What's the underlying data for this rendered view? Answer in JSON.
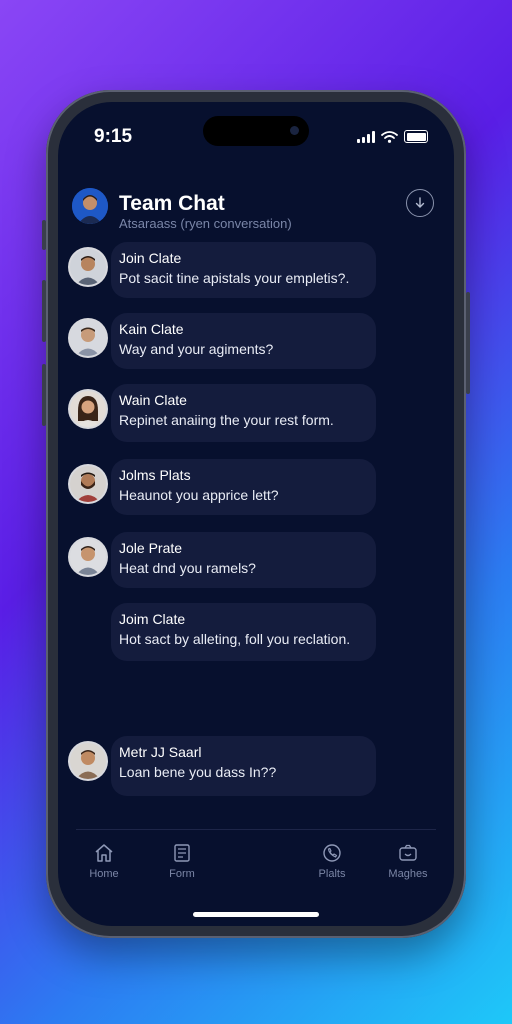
{
  "status_bar": {
    "time": "9:15"
  },
  "header": {
    "title": "Team Chat",
    "subtitle": "Atsaraass (ryen conversation)",
    "action_icon": "download-icon"
  },
  "messages": [
    {
      "name": "Join Clate",
      "text": "Pot sacit tine apistals your empletis?."
    },
    {
      "name": "Kain Clate",
      "text": "Way and your agiments?"
    },
    {
      "name": "Wain Clate",
      "text": "Repinet anaiing the your rest form."
    },
    {
      "name": "Jolms Plats",
      "text": "Heaunot you apprice lett?"
    },
    {
      "name": "Jole Prate",
      "text": "Heat dnd you ramels?"
    },
    {
      "name": "Joim Clate",
      "text": "Hot sact by alleting, foll you reclation."
    },
    {
      "name": "Metr JJ Saarl",
      "text": "Loan bene you dass In??"
    }
  ],
  "bottom_nav": [
    {
      "label": "Home",
      "icon": "home-icon"
    },
    {
      "label": "Form",
      "icon": "form-icon"
    },
    {
      "label": "Plalts",
      "icon": "phone-icon"
    },
    {
      "label": "Maghes",
      "icon": "camera-icon"
    }
  ],
  "colors": {
    "screen_background": "#07102e",
    "bubble_background": "#141c3d",
    "accent_blue": "#1e58c6"
  }
}
